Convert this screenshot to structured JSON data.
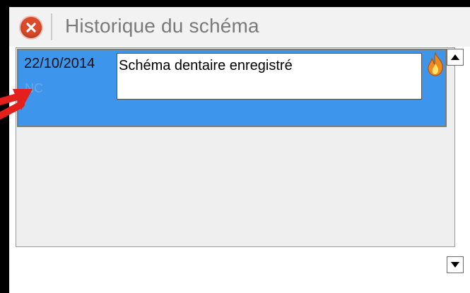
{
  "header": {
    "title": "Historique du schéma",
    "close_icon": "close-icon"
  },
  "history": {
    "entries": [
      {
        "date": "22/10/2014",
        "author": "NC",
        "comment": "Schéma dentaire enregistré",
        "icon": "flame-icon",
        "selected": true
      }
    ]
  },
  "scrollbar": {
    "up_icon": "chevron-up-icon",
    "down_icon": "chevron-down-icon"
  },
  "colors": {
    "selected_row": "#3d96ec",
    "close_button": "#dd4a2a",
    "annotation_arrow": "#e3201b"
  }
}
